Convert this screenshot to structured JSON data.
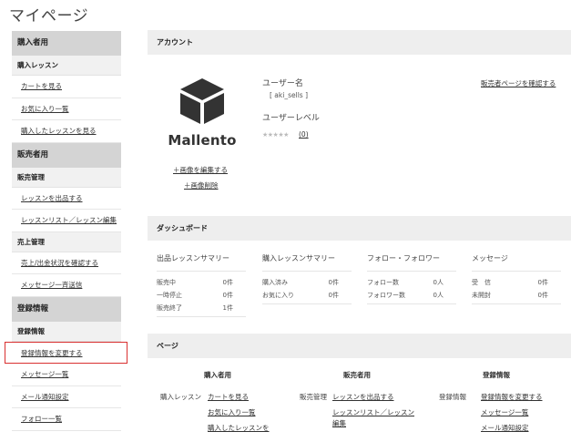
{
  "page_title": "マイページ",
  "sidebar": {
    "buyer_heading": "購入者用",
    "buyer_sub": "購入レッスン",
    "buyer_items": [
      "カートを見る",
      "お気に入り一覧",
      "購入したレッスンを見る"
    ],
    "seller_heading": "販売者用",
    "seller_sub1": "販売管理",
    "seller_items1": [
      "レッスンを出品する",
      "レッスンリスト／レッスン編集"
    ],
    "seller_sub2": "売上管理",
    "seller_items2": [
      "売上/出金状況を確認する",
      "メッセージ一斉送信"
    ],
    "reg_heading": "登録情報",
    "reg_sub": "登録情報",
    "reg_items": [
      "登録情報を変更する",
      "メッセージ一覧",
      "メール通知設定",
      "フォロー一覧"
    ]
  },
  "account": {
    "heading": "アカウント",
    "logo_text": "Mallento",
    "edit_image": "＋画像を編集する",
    "delete_image": "＋画像削除",
    "username_label": "ユーザー名",
    "username_value": "[ aki_sells ]",
    "level_label": "ユーザーレベル",
    "stars": "★★★★★",
    "rating_count": "(0)",
    "seller_page_link": "販売者ページを確認する"
  },
  "dashboard": {
    "heading": "ダッシュボード",
    "columns": [
      {
        "title": "出品レッスンサマリー",
        "rows": [
          [
            "販売中",
            "0件"
          ],
          [
            "一時停止",
            "0件"
          ],
          [
            "販売終了",
            "1件"
          ]
        ]
      },
      {
        "title": "購入レッスンサマリー",
        "rows": [
          [
            "購入済み",
            "0件"
          ],
          [
            "お気に入り",
            "0件"
          ]
        ]
      },
      {
        "title": "フォロー・フォロワー",
        "rows": [
          [
            "フォロー数",
            "0人"
          ],
          [
            "フォロワー数",
            "0人"
          ]
        ]
      },
      {
        "title": "メッセージ",
        "rows": [
          [
            "受　信",
            "0件"
          ],
          [
            "未開封",
            "0件"
          ]
        ]
      }
    ]
  },
  "page_section": {
    "heading": "ページ",
    "buyer_cat": "購入者用",
    "buyer_label": "購入レッスン",
    "buyer_links": [
      "カートを見る",
      "お気に入り一覧",
      "購入したレッスンを"
    ],
    "seller_cat": "販売者用",
    "seller_label": "販売管理",
    "seller_links": [
      "レッスンを出品する",
      "レッスンリスト／レッスン編集"
    ],
    "reg_cat": "登録情報",
    "reg_label": "登録情報",
    "reg_links": [
      "登録情報を変更する",
      "メッセージ一覧",
      "メール通知設定"
    ]
  }
}
